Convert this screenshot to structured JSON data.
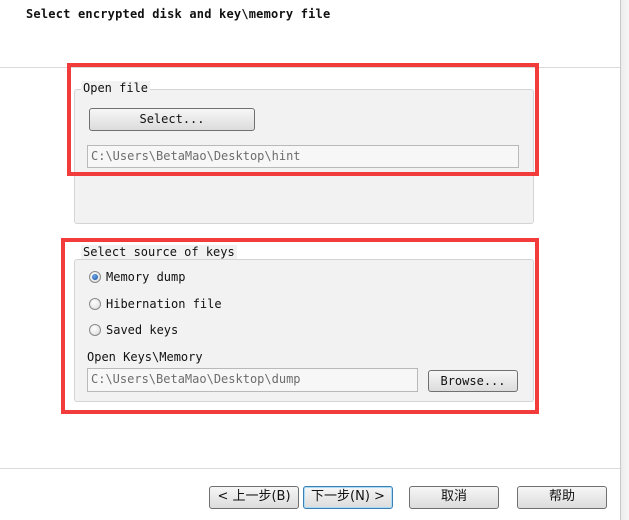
{
  "heading": "Select encrypted disk and key\\memory file",
  "open_file": {
    "legend": "Open file",
    "select_button": "Select...",
    "path": "C:\\Users\\BetaMao\\Desktop\\hint"
  },
  "keys": {
    "legend": "Select source of keys",
    "options": [
      {
        "label": "Memory dump",
        "checked": true
      },
      {
        "label": "Hibernation file",
        "checked": false
      },
      {
        "label": "Saved keys",
        "checked": false
      }
    ],
    "open_label": "Open Keys\\Memory",
    "path": "C:\\Users\\BetaMao\\Desktop\\dump",
    "browse_button": "Browse..."
  },
  "nav": {
    "back": "< 上一步(B)",
    "next": "下一步(N) >",
    "cancel": "取消",
    "help": "帮助"
  },
  "highlight_color": "#f23b3b"
}
